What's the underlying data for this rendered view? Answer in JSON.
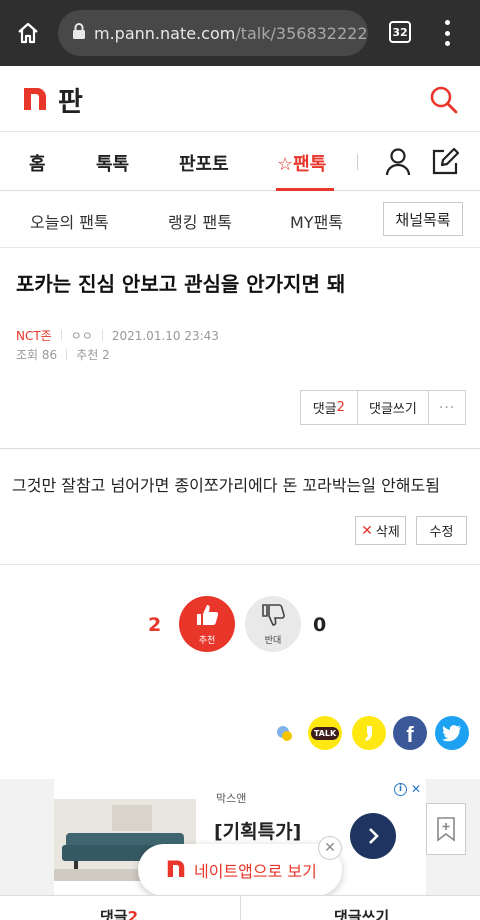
{
  "browser": {
    "url_domain": "m.pann.nate.com",
    "url_path": "/talk/356832222",
    "tab_count": "32"
  },
  "site": {
    "logo_letter": "n",
    "name": "판"
  },
  "nav": {
    "items": [
      "홈",
      "톡톡",
      "판포토",
      "팬톡"
    ],
    "active_index": 3,
    "active_prefix": "☆"
  },
  "subnav": {
    "items": [
      "오늘의 팬톡",
      "랭킹 팬톡",
      "MY팬톡"
    ],
    "channel_button": "채널목록"
  },
  "post": {
    "title": "포카는 진심 안보고 관심을 안가지면 돼",
    "category": "NCT존",
    "author": "ㅇㅇ",
    "date": "2021.01.10 23:43",
    "views_label": "조회",
    "views": "86",
    "recommend_label": "추천",
    "recommend": "2",
    "comment_label": "댓글",
    "comment_count": "2",
    "write_comment": "댓글쓰기",
    "more": "···",
    "body": "그것만 잘참고 넘어가면 종이쪼가리에다 돈 꼬라박는일 안해도됨",
    "delete_label": "삭제",
    "delete_mark": "✕",
    "edit_label": "수정"
  },
  "vote": {
    "up_count": "2",
    "up_label": "추천",
    "down_label": "반대",
    "down_count": "0"
  },
  "share": {
    "talk_label": "TALK",
    "facebook_label": "f",
    "icons": [
      "kakaostory-icon",
      "kakaotalk-icon",
      "kakaostory-alt-icon",
      "facebook-icon",
      "twitter-icon"
    ]
  },
  "ad": {
    "brand": "막스앤",
    "headline": "[기획특가]",
    "info_x": "✕"
  },
  "app_banner": {
    "logo_letter": "n",
    "text": "네이트앱으로 보기",
    "close": "✕"
  },
  "bottom": {
    "comment_label": "댓글",
    "comment_count": "2",
    "write_label": "댓글쓰기"
  },
  "colors": {
    "accent": "#e8362a",
    "browser_bar": "#2f2f2f",
    "facebook": "#3b5998",
    "twitter": "#1da1f2",
    "kakao": "#ffe812",
    "ad_button": "#1f3460"
  }
}
